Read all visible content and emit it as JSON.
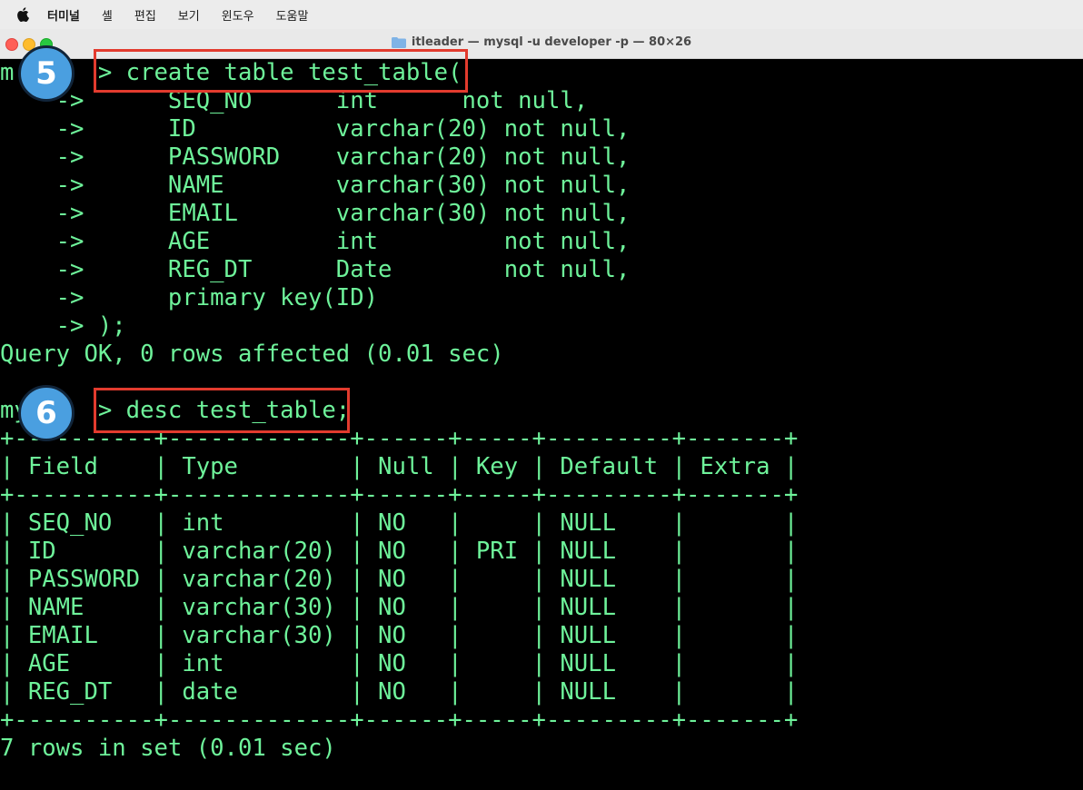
{
  "menubar": {
    "apple": "apple-logo-icon",
    "items": [
      "터미널",
      "셸",
      "편집",
      "보기",
      "윈도우",
      "도움말"
    ]
  },
  "window": {
    "title": "itleader — mysql -u developer -p — 80×26"
  },
  "terminal": {
    "lines": [
      "m      > create table test_table(",
      "    ->      SEQ_NO      int      not null,",
      "    ->      ID          varchar(20) not null,",
      "    ->      PASSWORD    varchar(20) not null,",
      "    ->      NAME        varchar(30) not null,",
      "    ->      EMAIL       varchar(30) not null,",
      "    ->      AGE         int         not null,",
      "    ->      REG_DT      Date        not null,",
      "    ->      primary key(ID)",
      "    -> );",
      "Query OK, 0 rows affected (0.01 sec)",
      "",
      "my     > desc test_table;",
      "+----------+-------------+------+-----+---------+-------+",
      "| Field    | Type        | Null | Key | Default | Extra |",
      "+----------+-------------+------+-----+---------+-------+",
      "| SEQ_NO   | int         | NO   |     | NULL    |       |",
      "| ID       | varchar(20) | NO   | PRI | NULL    |       |",
      "| PASSWORD | varchar(20) | NO   |     | NULL    |       |",
      "| NAME     | varchar(30) | NO   |     | NULL    |       |",
      "| EMAIL    | varchar(30) | NO   |     | NULL    |       |",
      "| AGE      | int         | NO   |     | NULL    |       |",
      "| REG_DT   | date        | NO   |     | NULL    |       |",
      "+----------+-------------+------+-----+---------+-------+",
      "7 rows in set (0.01 sec)"
    ]
  },
  "annotations": {
    "badge_5": "5",
    "badge_6": "6",
    "box_color": "#e23b2e",
    "badge_color": "#4a9fe0"
  },
  "colors": {
    "terminal_text": "#6ef29a",
    "terminal_bg": "#000000"
  }
}
